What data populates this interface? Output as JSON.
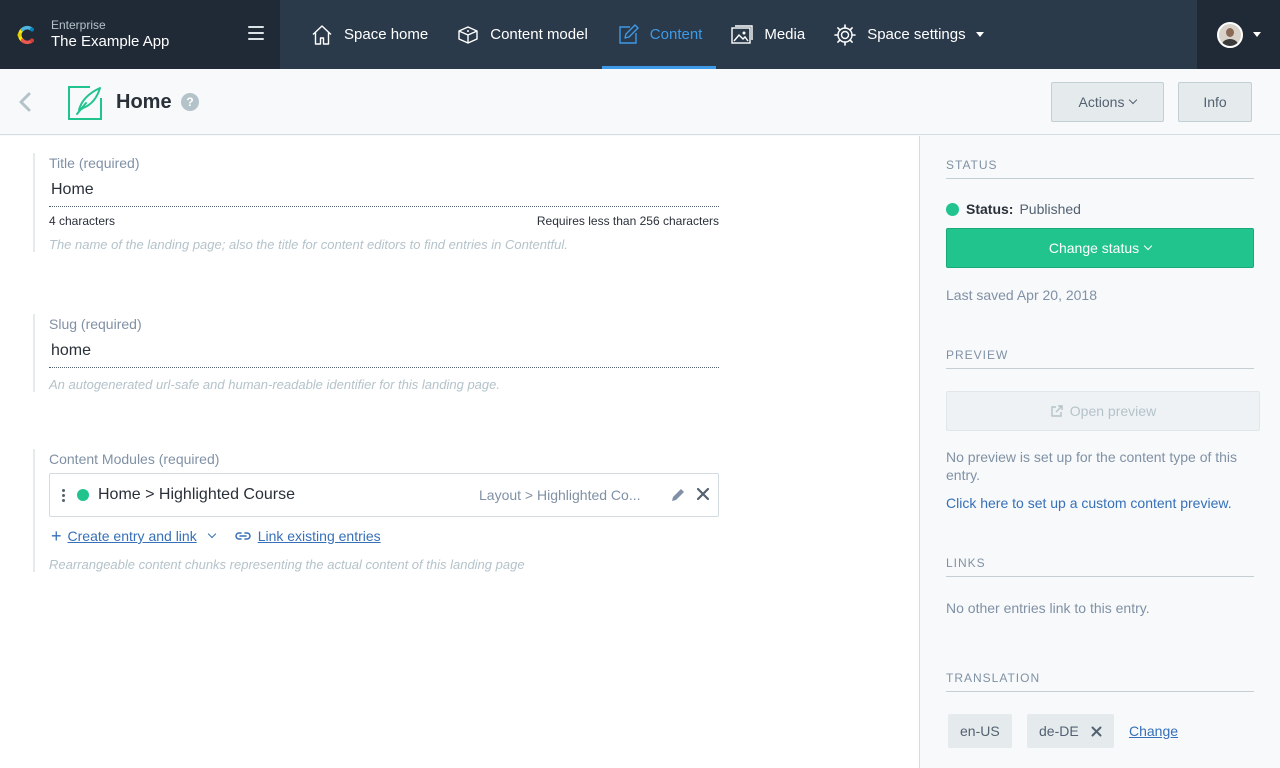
{
  "org": {
    "environment": "Enterprise",
    "app_name": "The Example App"
  },
  "nav": {
    "items": [
      {
        "label": "Space home",
        "icon": "home-icon"
      },
      {
        "label": "Content model",
        "icon": "cube-icon"
      },
      {
        "label": "Content",
        "icon": "edit-icon",
        "active": true
      },
      {
        "label": "Media",
        "icon": "media-icon"
      },
      {
        "label": "Space settings",
        "icon": "gear-icon"
      }
    ]
  },
  "entry": {
    "title": "Home",
    "help_glyph": "?",
    "actions_label": "Actions",
    "info_label": "Info"
  },
  "fields": {
    "title": {
      "label": "Title (required)",
      "value": "Home",
      "char_count": "4 characters",
      "limit": "Requires less than 256 characters",
      "help": "The name of the landing page; also the title for content editors to find entries in Contentful."
    },
    "slug": {
      "label": "Slug (required)",
      "value": "home",
      "help": "An autogenerated url-safe and human-readable identifier for this landing page."
    },
    "modules": {
      "label": "Content Modules (required)",
      "reference_title": "Home > Highlighted Course",
      "reference_type": "Layout > Highlighted Co...",
      "create_link": "Create entry and link",
      "link_existing": "Link existing entries",
      "help": "Rearrangeable content chunks representing the actual content of this landing page"
    }
  },
  "sidebar": {
    "status_heading": "STATUS",
    "status_label": "Status:",
    "status_value": "Published",
    "change_status": "Change status",
    "last_saved": "Last saved Apr 20, 2018",
    "preview_heading": "PREVIEW",
    "open_preview": "Open preview",
    "preview_note": "No preview is set up for the content type of this entry.",
    "preview_link": "Click here to set up a custom content preview.",
    "links_heading": "LINKS",
    "links_note": "No other entries link to this entry.",
    "translation_heading": "TRANSLATION",
    "locales": [
      "en-US",
      "de-DE"
    ],
    "change_label": "Change"
  },
  "colors": {
    "topbar": "#2b3a4a",
    "accent_blue": "#3c9ae8",
    "published_green": "#21c48d",
    "link_blue": "#3670b8"
  }
}
